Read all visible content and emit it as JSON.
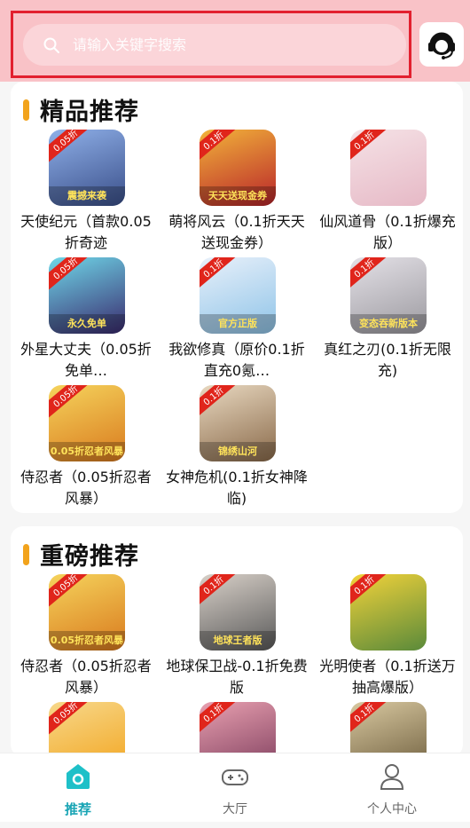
{
  "search": {
    "placeholder": "请输入关键字搜索"
  },
  "sections": [
    {
      "title": "精品推荐",
      "items": [
        {
          "name": "天使纪元（首款0.05折奇迹",
          "badge": "0.05折",
          "banner": "震撼来袭",
          "colors": [
            "#3a4f8a",
            "#8fb0e8"
          ]
        },
        {
          "name": "萌将风云（0.1折天天送现金券）",
          "badge": "0.1折",
          "banner": "天天送现金券",
          "colors": [
            "#b8242a",
            "#f2b33a"
          ]
        },
        {
          "name": "仙风道骨（0.1折爆充版）",
          "badge": "0.1折",
          "banner": "",
          "colors": [
            "#e6b9c6",
            "#f5e2e6"
          ]
        },
        {
          "name": "外星大丈夫（0.05折免单…",
          "badge": "0.05折",
          "banner": "永久免单",
          "colors": [
            "#3a2a6e",
            "#6fd7e8"
          ]
        },
        {
          "name": "我欲修真（原价0.1折直充0氪…",
          "badge": "0.1折",
          "banner": "官方正版",
          "colors": [
            "#8fc4e8",
            "#e8f0fa"
          ]
        },
        {
          "name": "真红之刃(0.1折无限充)",
          "badge": "0.1折",
          "banner": "变态吞新版本",
          "colors": [
            "#9c9aa0",
            "#e3e0e6"
          ]
        },
        {
          "name": "侍忍者（0.05折忍者风暴）",
          "badge": "0.05折",
          "banner": "0.05折忍者风暴",
          "colors": [
            "#d97a1e",
            "#f5d35c"
          ]
        },
        {
          "name": "女神危机(0.1折女神降临)",
          "badge": "0.1折",
          "banner": "锦绣山河",
          "colors": [
            "#8a6a4a",
            "#e8d8c0"
          ]
        }
      ]
    },
    {
      "title": "重磅推荐",
      "items": [
        {
          "name": "侍忍者（0.05折忍者风暴）",
          "badge": "0.05折",
          "banner": "0.05折忍者风暴",
          "colors": [
            "#d97a1e",
            "#f5d35c"
          ]
        },
        {
          "name": "地球保卫战-0.1折免费版",
          "badge": "0.1折",
          "banner": "地球王者版",
          "colors": [
            "#5a5a5a",
            "#d8d0c8"
          ]
        },
        {
          "name": "光明使者（0.1折送万抽高爆版）",
          "badge": "0.1折",
          "banner": "",
          "colors": [
            "#5a8a3a",
            "#f2d23a"
          ]
        },
        {
          "name": "",
          "badge": "0.05折",
          "banner": "",
          "colors": [
            "#f2a31c",
            "#f7d88a"
          ]
        },
        {
          "name": "",
          "badge": "0.1折",
          "banner": "",
          "colors": [
            "#7a3a5a",
            "#e8a0b0"
          ]
        },
        {
          "name": "",
          "badge": "0.1折",
          "banner": "",
          "colors": [
            "#6a5a3a",
            "#d8c8a0"
          ]
        }
      ]
    }
  ],
  "nav": [
    {
      "label": "推荐",
      "icon": "home-icon",
      "active": true
    },
    {
      "label": "大厅",
      "icon": "gamepad-icon",
      "active": false
    },
    {
      "label": "个人中心",
      "icon": "user-icon",
      "active": false
    }
  ],
  "colors": {
    "accent": "#1aa5b5",
    "topbar": "#f9c2c7",
    "highlight": "#e2202f",
    "title_bar": "#f2a31c"
  }
}
